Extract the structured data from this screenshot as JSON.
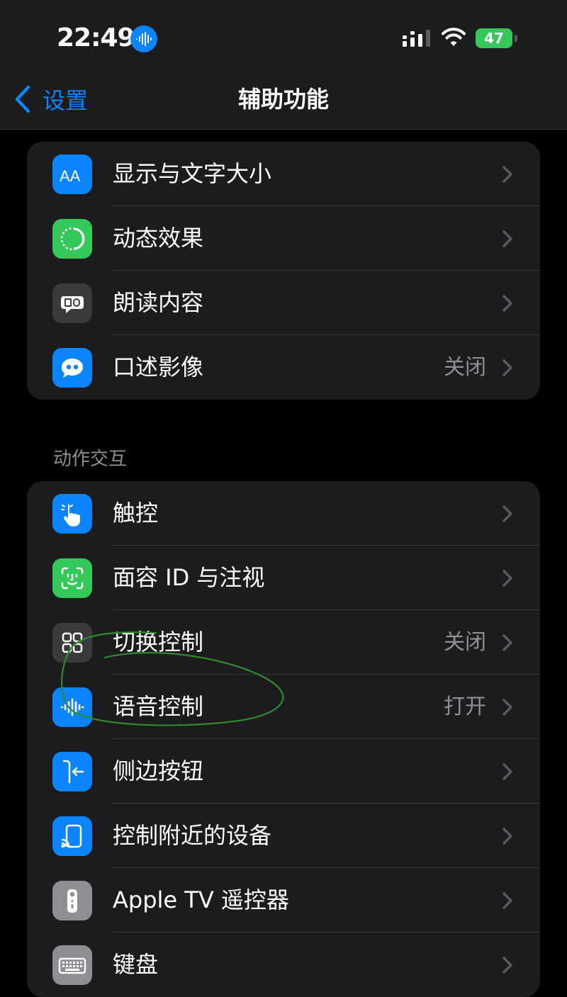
{
  "status_bar": {
    "time": "22:49",
    "battery": "47"
  },
  "nav": {
    "back_label": "设置",
    "title": "辅助功能"
  },
  "group_vision": {
    "items": [
      {
        "label": "显示与文字大小",
        "value": "",
        "icon": "text-size-icon"
      },
      {
        "label": "动态效果",
        "value": "",
        "icon": "motion-icon"
      },
      {
        "label": "朗读内容",
        "value": "",
        "icon": "spoken-content-icon"
      },
      {
        "label": "口述影像",
        "value": "关闭",
        "icon": "audio-description-icon"
      }
    ]
  },
  "section_interaction": {
    "header": "动作交互",
    "items": [
      {
        "label": "触控",
        "value": "",
        "icon": "touch-hand-icon"
      },
      {
        "label": "面容 ID 与注视",
        "value": "",
        "icon": "face-id-icon"
      },
      {
        "label": "切换控制",
        "value": "关闭",
        "icon": "switch-control-icon"
      },
      {
        "label": "语音控制",
        "value": "打开",
        "icon": "voice-control-icon"
      },
      {
        "label": "侧边按钮",
        "value": "",
        "icon": "side-button-icon"
      },
      {
        "label": "控制附近的设备",
        "value": "",
        "icon": "nearby-devices-icon"
      },
      {
        "label": "Apple TV 遥控器",
        "value": "",
        "icon": "apple-tv-remote-icon"
      },
      {
        "label": "键盘",
        "value": "",
        "icon": "keyboard-icon"
      }
    ]
  },
  "colors": {
    "accent": "#0a84ff",
    "green": "#34c759",
    "gray_icon": "#3a3a3c",
    "light_gray_icon": "#8e8e93",
    "annotation_circle": "#2f8a2f"
  }
}
